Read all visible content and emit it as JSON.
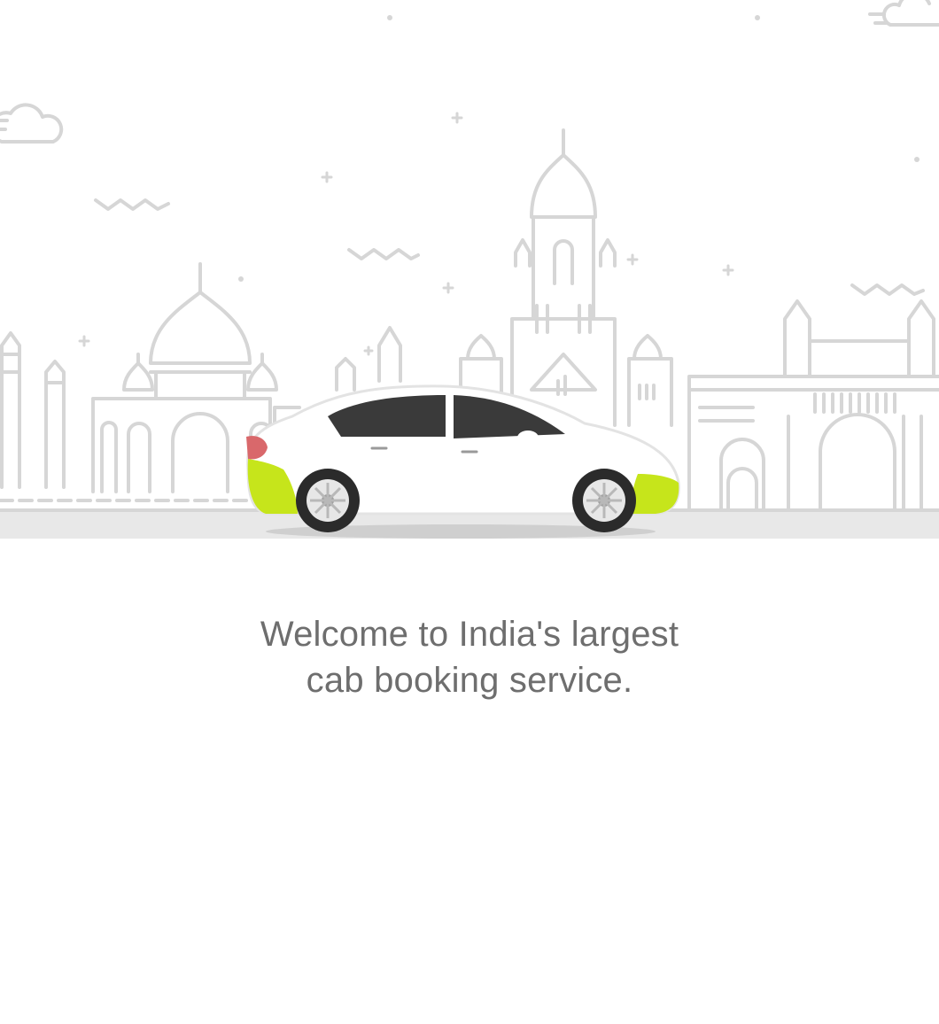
{
  "colors": {
    "background": "#ffffff",
    "skyline_stroke": "#d6d6d6",
    "road": "#e8e8e8",
    "car_body": "#ffffff",
    "car_accent": "#c6e51b",
    "text": "#6e6e6e"
  },
  "illustration": {
    "icons": [
      "cloud-icon",
      "bird-icon",
      "sparkle-icon",
      "taj-mahal-icon",
      "railway-terminus-icon",
      "gateway-arch-icon",
      "cab-car-icon"
    ]
  },
  "welcome": {
    "line1": "Welcome to India's largest",
    "line2": "cab booking service."
  }
}
